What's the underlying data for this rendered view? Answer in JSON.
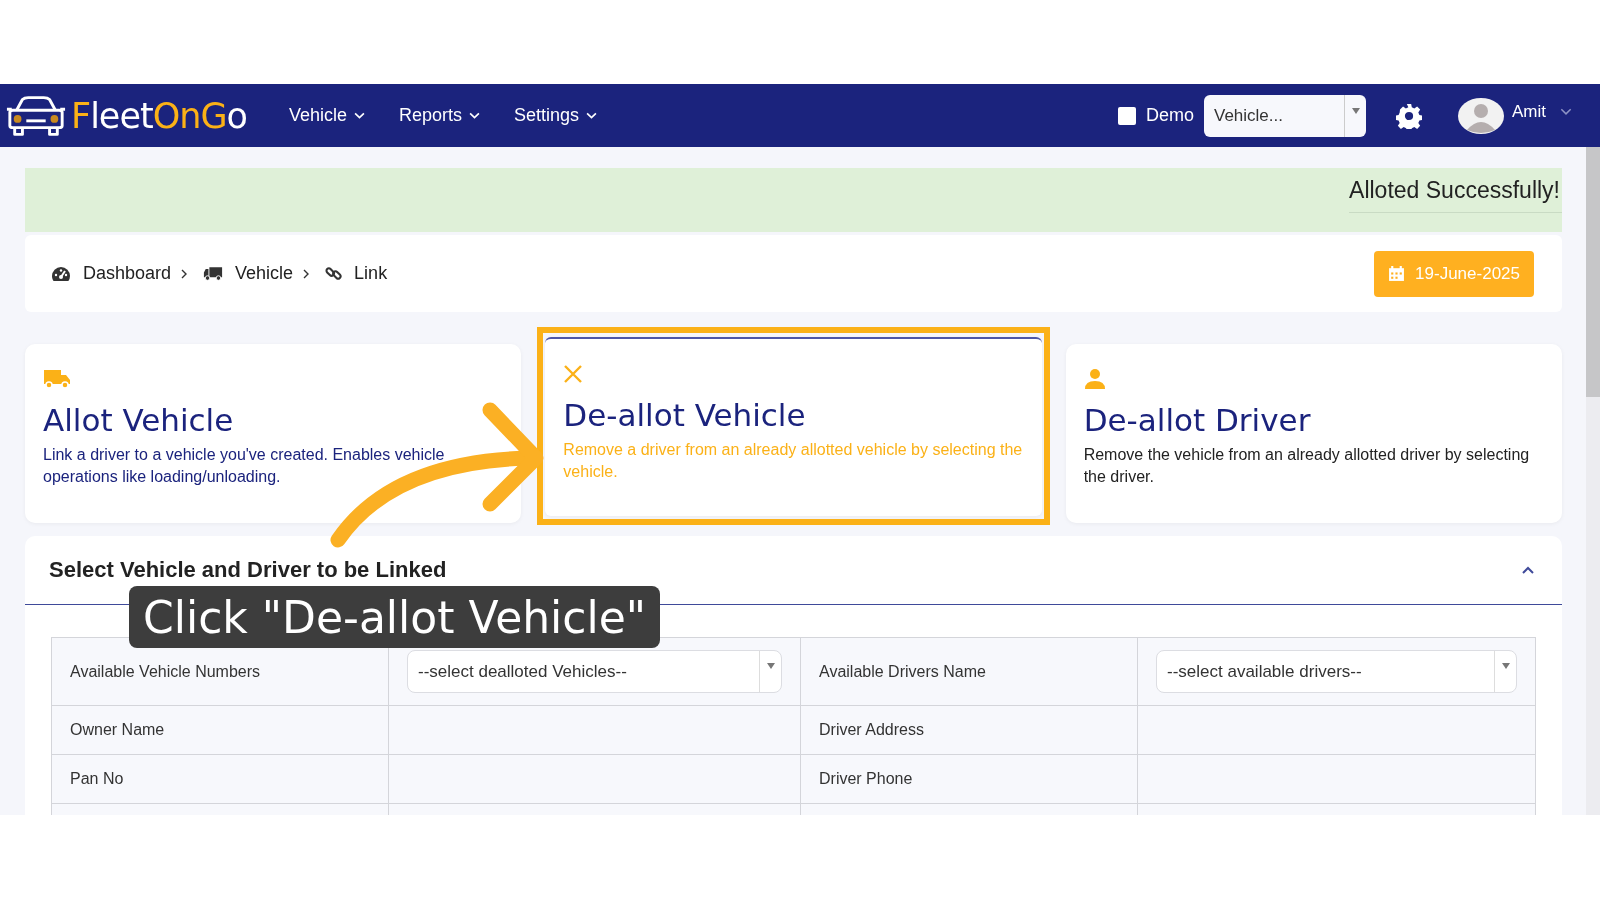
{
  "navbar": {
    "logo": [
      {
        "text": "F",
        "color": "#fbb117"
      },
      {
        "text": "leet",
        "color": "#ffffff"
      },
      {
        "text": "OnG",
        "color": "#fbb117"
      },
      {
        "text": "o",
        "color": "#ffffff"
      }
    ],
    "menu": [
      {
        "label": "Vehicle"
      },
      {
        "label": "Reports"
      },
      {
        "label": "Settings"
      }
    ],
    "demo": {
      "label": "Demo",
      "checked": false
    },
    "vehicle_select": {
      "value": "Vehicle..."
    },
    "user": {
      "name": "Amit"
    }
  },
  "alert": {
    "message": "Alloted Successfully!"
  },
  "breadcrumb": [
    {
      "label": "Dashboard",
      "kind": "gauge"
    },
    {
      "label": "Vehicle",
      "kind": "truck"
    },
    {
      "label": "Link",
      "kind": "link"
    }
  ],
  "date_button": {
    "label": "19-June-2025"
  },
  "cards": [
    {
      "kind": "truck",
      "title": "Allot Vehicle",
      "description": "Link a driver to a vehicle you've created. Enables vehicle operations like loading/unloading.",
      "selected": false
    },
    {
      "kind": "cross",
      "title": "De-allot Vehicle",
      "description": "Remove a driver from an already allotted vehicle by selecting the vehicle.",
      "selected": true
    },
    {
      "kind": "person",
      "title": "De-allot Driver",
      "description": "Remove the vehicle from an already allotted driver by selecting the driver.",
      "selected": false
    }
  ],
  "section": {
    "title": "Select Vehicle and Driver to be Linked",
    "expanded": true
  },
  "table": {
    "rows": [
      {
        "cells": [
          {
            "kind": "label",
            "text": "Available Vehicle Numbers"
          },
          {
            "kind": "select",
            "value": "--select dealloted Vehicles--"
          },
          {
            "kind": "label",
            "text": "Available Drivers Name"
          },
          {
            "kind": "select",
            "value": "--select available drivers--"
          }
        ]
      },
      {
        "cells": [
          {
            "kind": "label",
            "text": "Owner Name"
          },
          {
            "kind": "empty"
          },
          {
            "kind": "label",
            "text": "Driver Address"
          },
          {
            "kind": "empty"
          }
        ]
      },
      {
        "cells": [
          {
            "kind": "label",
            "text": "Pan No"
          },
          {
            "kind": "empty"
          },
          {
            "kind": "label",
            "text": "Driver Phone"
          },
          {
            "kind": "empty"
          }
        ]
      }
    ]
  },
  "tutorial": {
    "caption": "Click \"De-allot Vehicle\""
  }
}
